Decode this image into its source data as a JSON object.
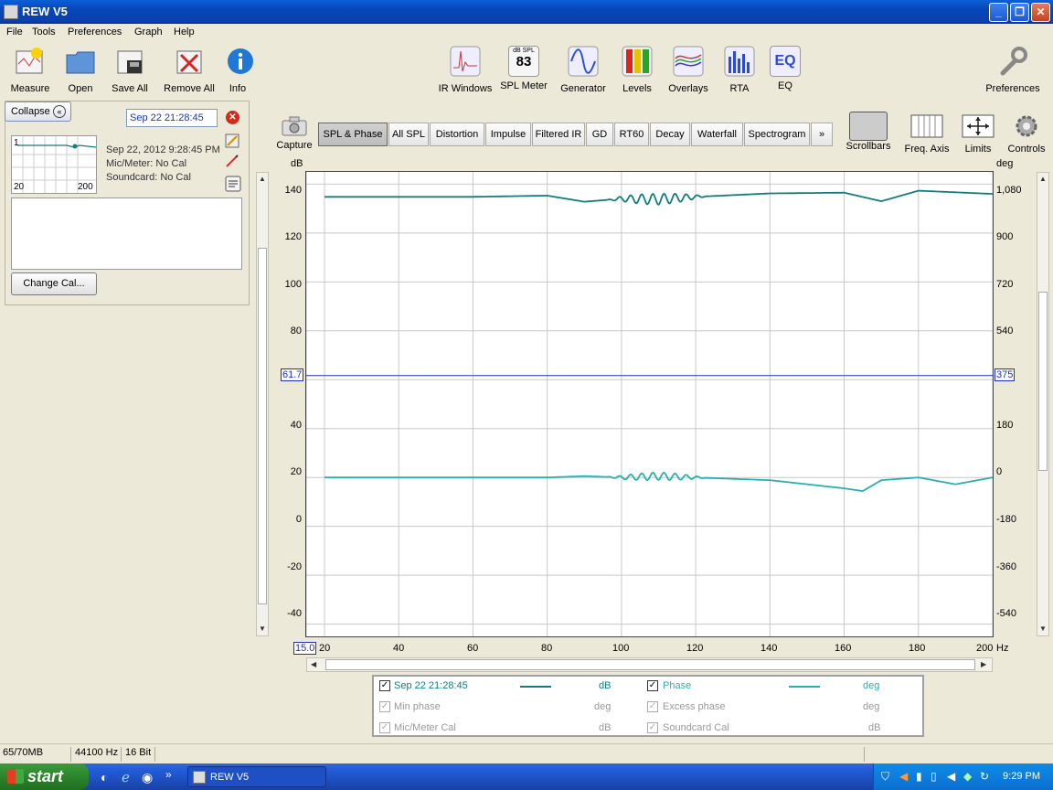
{
  "window": {
    "title": "REW V5"
  },
  "menu": [
    "File",
    "Tools",
    "Preferences",
    "Graph",
    "Help"
  ],
  "toolbar": {
    "measure": "Measure",
    "open": "Open",
    "save_all": "Save All",
    "remove_all": "Remove All",
    "info": "Info",
    "ir_windows": "IR Windows",
    "spl_meter": "SPL Meter",
    "spl_meter_value": "83",
    "spl_meter_unit": "dB SPL",
    "generator": "Generator",
    "levels": "Levels",
    "overlays": "Overlays",
    "rta": "RTA",
    "eq": "EQ",
    "eq_icon_text": "EQ",
    "preferences": "Preferences"
  },
  "panel": {
    "collapse": "Collapse",
    "measurement_name": "Sep 22 21:28:45",
    "thumb_index": "1",
    "thumb_x_min": "20",
    "thumb_x_max": "200",
    "timestamp": "Sep 22, 2012 9:28:45 PM",
    "mic_meter": "Mic/Meter: No Cal",
    "soundcard": "Soundcard: No Cal",
    "change_cal": "Change Cal..."
  },
  "graph_toolbar": {
    "capture": "Capture",
    "tabs": [
      "SPL & Phase",
      "All SPL",
      "Distortion",
      "Impulse",
      "Filtered IR",
      "GD",
      "RT60",
      "Decay",
      "Waterfall",
      "Spectrogram",
      "»"
    ],
    "active_tab": "SPL & Phase",
    "scrollbars": "Scrollbars",
    "freq_axis": "Freq. Axis",
    "limits": "Limits",
    "controls": "Controls"
  },
  "axes": {
    "left_unit": "dB",
    "right_unit": "deg",
    "x_unit": "Hz",
    "left_ticks": [
      "140",
      "120",
      "100",
      "80",
      "40",
      "20",
      "0",
      "-20",
      "-40"
    ],
    "right_ticks": [
      "1,080",
      "900",
      "720",
      "540",
      "180",
      "0",
      "-180",
      "-360",
      "-540"
    ],
    "x_ticks": [
      "20",
      "40",
      "60",
      "80",
      "100",
      "120",
      "140",
      "160",
      "180",
      "200"
    ],
    "cursor_left": "61.7",
    "cursor_right": "375",
    "x_cursor": "15.0"
  },
  "chart_data": {
    "type": "line",
    "x_range": [
      20,
      200
    ],
    "y_range": [
      -45,
      145
    ],
    "y_right_range": [
      -585,
      1125
    ],
    "series": [
      {
        "name": "Sep 22 21:28:45",
        "unit": "dB",
        "color": "#127d7d",
        "x": [
          20,
          60,
          80,
          90,
          100,
          110,
          120,
          140,
          160,
          170,
          180,
          200
        ],
        "y": [
          134.8,
          134.8,
          135.3,
          132.8,
          134.0,
          133.8,
          134.8,
          136.2,
          136.5,
          133.0,
          137.3,
          136.0
        ]
      },
      {
        "name": "Phase",
        "unit": "deg",
        "color": "#28b0b0",
        "x": [
          20,
          60,
          80,
          90,
          100,
          110,
          120,
          140,
          160,
          165,
          170,
          180,
          190,
          200
        ],
        "y": [
          0,
          0,
          0,
          5,
          0,
          5,
          0,
          -10,
          -40,
          -50,
          -10,
          0,
          -25,
          0
        ]
      }
    ]
  },
  "legend": {
    "series1": "Sep 22 21:28:45",
    "series1_unit": "dB",
    "phase": "Phase",
    "phase_unit": "deg",
    "min_phase": "Min phase",
    "min_phase_unit": "deg",
    "excess_phase": "Excess phase",
    "excess_phase_unit": "deg",
    "mic_cal": "Mic/Meter Cal",
    "mic_cal_unit": "dB",
    "sc_cal": "Soundcard Cal",
    "sc_cal_unit": "dB"
  },
  "status": {
    "memory": "65/70MB",
    "rate": "44100 Hz",
    "bits": "16 Bit"
  },
  "taskbar": {
    "start": "start",
    "task": "REW V5",
    "clock": "9:29 PM"
  }
}
